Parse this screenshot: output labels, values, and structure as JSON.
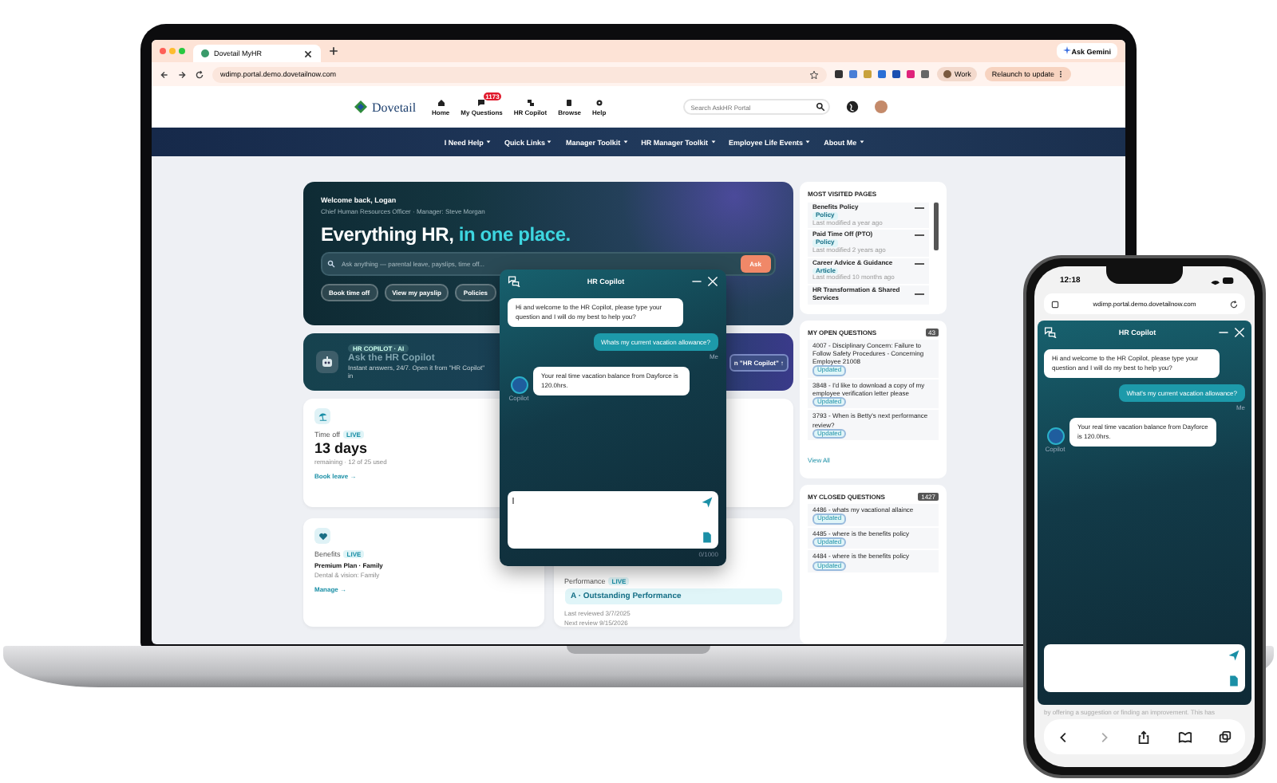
{
  "browser": {
    "tab_title": "Dovetail MyHR",
    "gemini": "Ask Gemini",
    "url": "wdimp.portal.demo.dovetailnow.com",
    "profile": "Work",
    "relaunch": "Relaunch to update"
  },
  "header": {
    "logo": "Dovetail",
    "nav": [
      {
        "label": "Home"
      },
      {
        "label": "My Questions",
        "badge": "1173"
      },
      {
        "label": "HR Copilot"
      },
      {
        "label": "Browse"
      },
      {
        "label": "Help"
      }
    ],
    "search": {
      "placeholder": "Search AskHR Portal"
    }
  },
  "menu": [
    "I Need Help",
    "Quick Links",
    "Manager Toolkit",
    "HR Manager Toolkit",
    "Employee Life Events",
    "About Me"
  ],
  "hero": {
    "welcome": "Welcome back, Logan",
    "subtitle": "Chief Human Resources Officer · Manager: Steve Morgan",
    "title_lead": "Everything HR,",
    "title_highlight": "in one place.",
    "search": {
      "placeholder": "Ask anything — parental leave, payslips, time off..."
    },
    "ask": "Ask",
    "chips": [
      "Book time off",
      "View my payslip",
      "Policies"
    ]
  },
  "copilot_card": {
    "badge": "HR COPILOT · AI",
    "title": "Ask the HR Copilot",
    "text": "Instant answers, 24/7. Open it from \"HR Copilot\" in",
    "button": "n \"HR Copilot\" ↑"
  },
  "cards": [
    {
      "kind": "timeoff",
      "title": "Time off",
      "tag": "LIVE",
      "value": "13 days",
      "detail": "remaining · 12 of 25 used",
      "link": "Book leave →"
    },
    {
      "kind": "blank"
    },
    {
      "kind": "benefits",
      "title": "Benefits",
      "tag": "LIVE",
      "value": "Premium Plan · Family",
      "detail": "Dental & vision: Family",
      "link": "Manage →"
    },
    {
      "kind": "performance",
      "title": "Performance",
      "tag": "LIVE",
      "value": "A · Outstanding Performance",
      "detail": "Last reviewed 3/7/2025",
      "detail2": "Next review 9/15/2026"
    }
  ],
  "sidebar": {
    "visited_title": "MOST VISITED PAGES",
    "visited": [
      {
        "title": "Benefits Policy",
        "tag": "Policy",
        "meta": "Last modified a year ago"
      },
      {
        "title": "Paid Time Off (PTO)",
        "tag": "Policy",
        "meta": "Last modified 2 years ago"
      },
      {
        "title": "Career Advice & Guidance",
        "tag": "Article",
        "meta": "Last modified 10 months ago"
      },
      {
        "title": "HR Transformation & Shared Services"
      }
    ],
    "open_title": "MY OPEN QUESTIONS",
    "open_count": "43",
    "open": [
      {
        "title": "4007 - Disciplinary Concern: Failure to Follow Safety Procedures - Concerning Employee 21008",
        "tag": "Updated"
      },
      {
        "title": "3848 - I'd like to download a copy of my employee verification letter please",
        "tag": "Updated"
      },
      {
        "title": "3793 - When is Betty's next performance review?",
        "tag": "Updated"
      }
    ],
    "view_all": "View All",
    "closed_title": "MY CLOSED QUESTIONS",
    "closed_count": "1427",
    "closed": [
      {
        "title": "4486 - whats my vacational allaince",
        "tag": "Updated"
      },
      {
        "title": "4485 - where is the benefits policy",
        "tag": "Updated"
      },
      {
        "title": "4484 - where is the benefits policy",
        "tag": "Updated"
      }
    ]
  },
  "chat": {
    "title": "HR Copilot",
    "messages": [
      {
        "kind": "bot",
        "text": "Hi and welcome to the HR Copilot, please type your question and I will do my best to help you?"
      },
      {
        "kind": "user",
        "text": "Whats my current vacation allowance?",
        "meta": "Me"
      },
      {
        "kind": "bot",
        "text": "Your real time vacation balance from Dayforce is 120.0hrs.",
        "meta": "Copilot"
      }
    ],
    "counter": "0/1000"
  },
  "phone": {
    "time": "12:18",
    "url": "wdimp.portal.demo.dovetailnow.com",
    "chat": {
      "title": "HR Copilot",
      "messages": [
        {
          "kind": "bot",
          "text": "Hi and welcome to the HR Copilot, please type your question and I will do my best to help you?"
        },
        {
          "kind": "user",
          "text": "What's my current vacation allowance?",
          "meta": "Me"
        },
        {
          "kind": "bot",
          "text": "Your real time vacation balance from Dayforce is 120.0hrs.",
          "meta": "Copilot"
        }
      ]
    },
    "page_text": "by offering a suggestion or finding an improvement. This has"
  }
}
